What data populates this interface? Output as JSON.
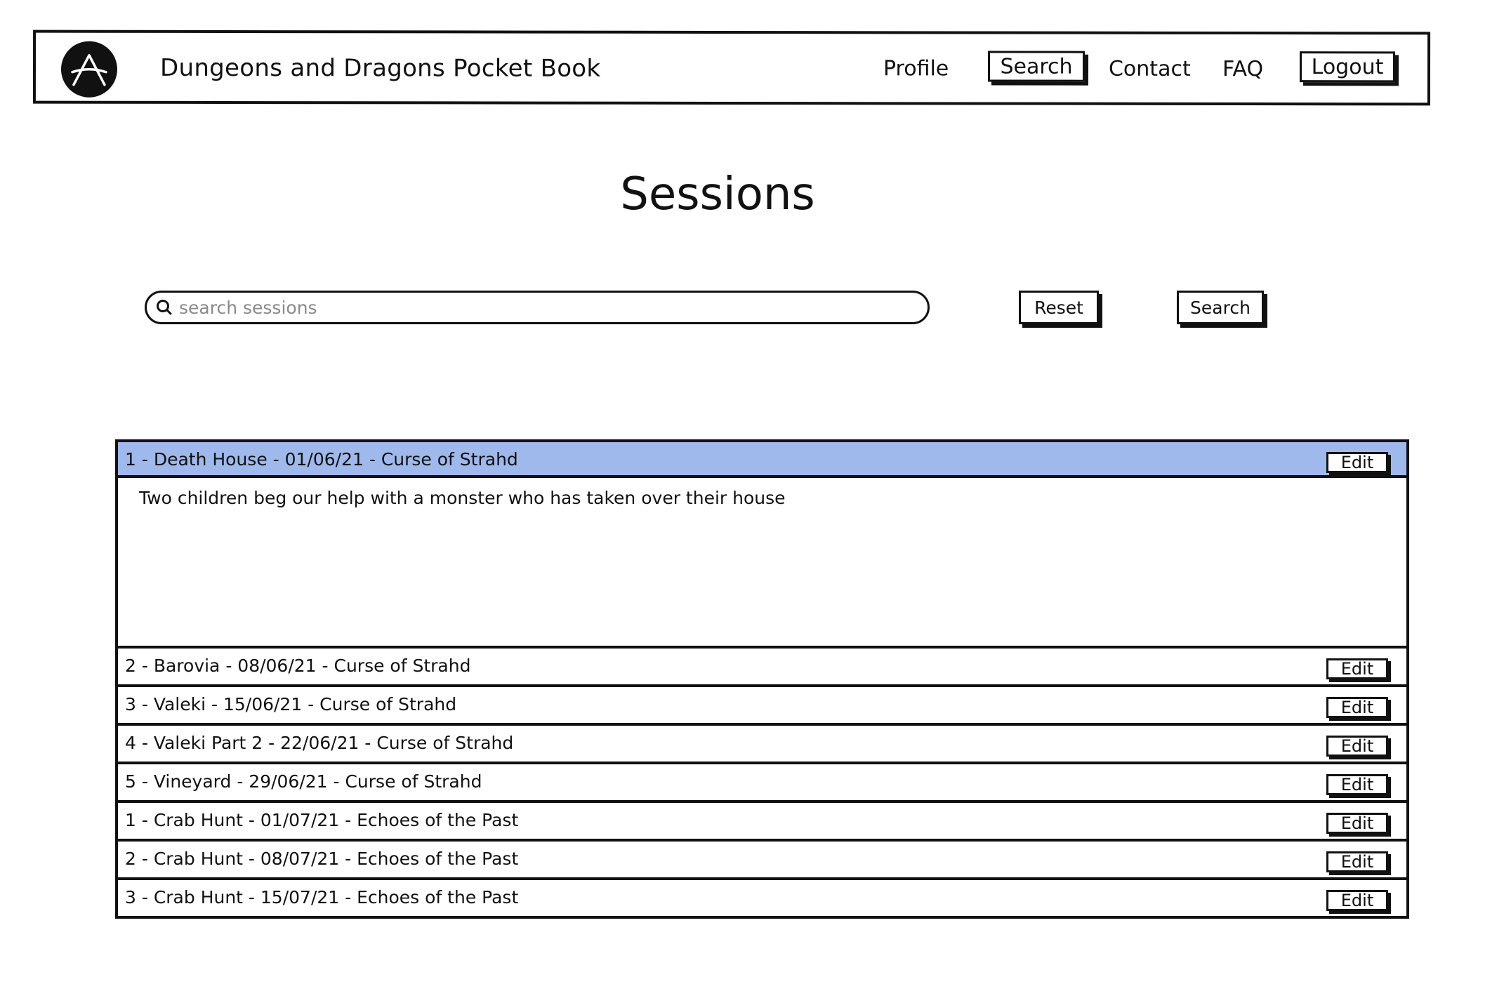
{
  "header": {
    "title": "Dungeons and Dragons Pocket Book",
    "logo_icon": "a-logo-icon",
    "nav": {
      "profile": "Profile",
      "search": "Search",
      "contact": "Contact",
      "faq": "FAQ",
      "logout": "Logout"
    }
  },
  "page": {
    "title": "Sessions"
  },
  "search": {
    "placeholder": "search sessions",
    "value": "",
    "icon": "search-icon",
    "reset_label": "Reset",
    "search_label": "Search"
  },
  "sessions": {
    "highlight_color": "#a0b9ec",
    "edit_label": "Edit",
    "items": [
      {
        "label": "1 - Death House - 01/06/21 - Curse of Strahd",
        "expanded": true,
        "description": "Two children beg our help with a monster who has taken over their house"
      },
      {
        "label": "2 - Barovia - 08/06/21 - Curse of Strahd"
      },
      {
        "label": "3 - Valeki - 15/06/21 - Curse of Strahd"
      },
      {
        "label": "4 - Valeki Part 2 - 22/06/21 - Curse of Strahd"
      },
      {
        "label": "5 - Vineyard - 29/06/21 - Curse of Strahd"
      },
      {
        "label": "1 - Crab Hunt - 01/07/21 - Echoes of the Past"
      },
      {
        "label": "2 - Crab Hunt - 08/07/21 - Echoes of the Past"
      },
      {
        "label": "3 - Crab Hunt - 15/07/21 - Echoes of the Past"
      }
    ]
  }
}
